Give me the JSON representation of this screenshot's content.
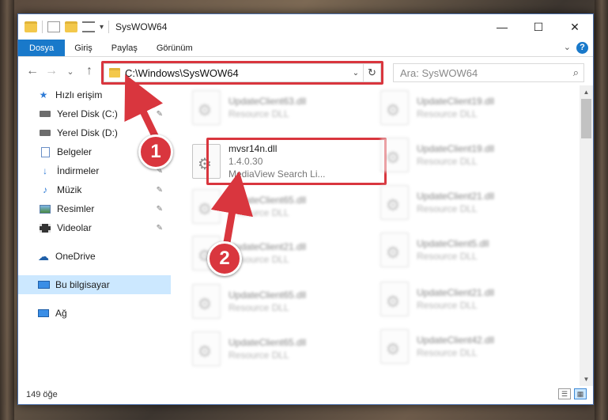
{
  "window": {
    "title": "SysWOW64",
    "qa_dropdown": "▾",
    "controls": {
      "minimize": "—",
      "maximize": "☐",
      "close": "✕"
    }
  },
  "ribbon": {
    "tabs": [
      {
        "label": "Dosya",
        "active": true
      },
      {
        "label": "Giriş"
      },
      {
        "label": "Paylaş"
      },
      {
        "label": "Görünüm"
      }
    ],
    "expand_chevron": "⌄",
    "help": "?"
  },
  "nav": {
    "back": "←",
    "forward": "→",
    "recent": "⌄",
    "up": "↑",
    "address": "C:\\Windows\\SysWOW64",
    "address_dropdown": "⌄",
    "refresh": "↻",
    "search_placeholder": "Ara: SysWOW64",
    "search_icon": "⌕"
  },
  "sidebar": {
    "quick_access": {
      "label": "Hızlı erişim",
      "icon": "star-icon"
    },
    "items": [
      {
        "label": "Yerel Disk (C:)",
        "icon": "drive-icon",
        "pinned": true
      },
      {
        "label": "Yerel Disk (D:)",
        "icon": "drive-icon",
        "pinned": false
      },
      {
        "label": "Belgeler",
        "icon": "documents-icon",
        "pinned": true
      },
      {
        "label": "İndirmeler",
        "icon": "download-icon",
        "pinned": true
      },
      {
        "label": "Müzik",
        "icon": "music-icon",
        "pinned": true
      },
      {
        "label": "Resimler",
        "icon": "pictures-icon",
        "pinned": true
      },
      {
        "label": "Videolar",
        "icon": "videos-icon",
        "pinned": true
      }
    ],
    "onedrive": "OneDrive",
    "this_pc": "Bu bilgisayar",
    "network": "Ağ",
    "pin_glyph": "📌"
  },
  "files": {
    "highlighted": {
      "name": "mvsr14n.dll",
      "version": "1.4.0.30",
      "description": "MediaView Search Li..."
    },
    "left_column": [
      {
        "name": "UpdateClient63.dll",
        "type": "Resource DLL"
      },
      {
        "name": "UpdateClient65.dll",
        "type": "Resource DLL"
      },
      {
        "name": "UpdateClient21.dll",
        "type": "Resource DLL"
      },
      {
        "name": "UpdateClient65.dll",
        "type": "Resource DLL"
      },
      {
        "name": "UpdateClient65.dll",
        "type": "Resource DLL"
      }
    ],
    "right_column": [
      {
        "name": "UpdateClient19.dll",
        "type": "Resource DLL"
      },
      {
        "name": "UpdateClient19.dll",
        "type": "Resource DLL"
      },
      {
        "name": "UpdateClient21.dll",
        "type": "Resource DLL"
      },
      {
        "name": "UpdateClient5.dll",
        "type": "Resource DLL"
      },
      {
        "name": "UpdateClient21.dll",
        "type": "Resource DLL"
      },
      {
        "name": "UpdateClient42.dll",
        "type": "Resource DLL"
      }
    ]
  },
  "status": {
    "count": "149 öğe"
  },
  "annotations": {
    "step1": "1",
    "step2": "2",
    "color": "#d9363e"
  }
}
